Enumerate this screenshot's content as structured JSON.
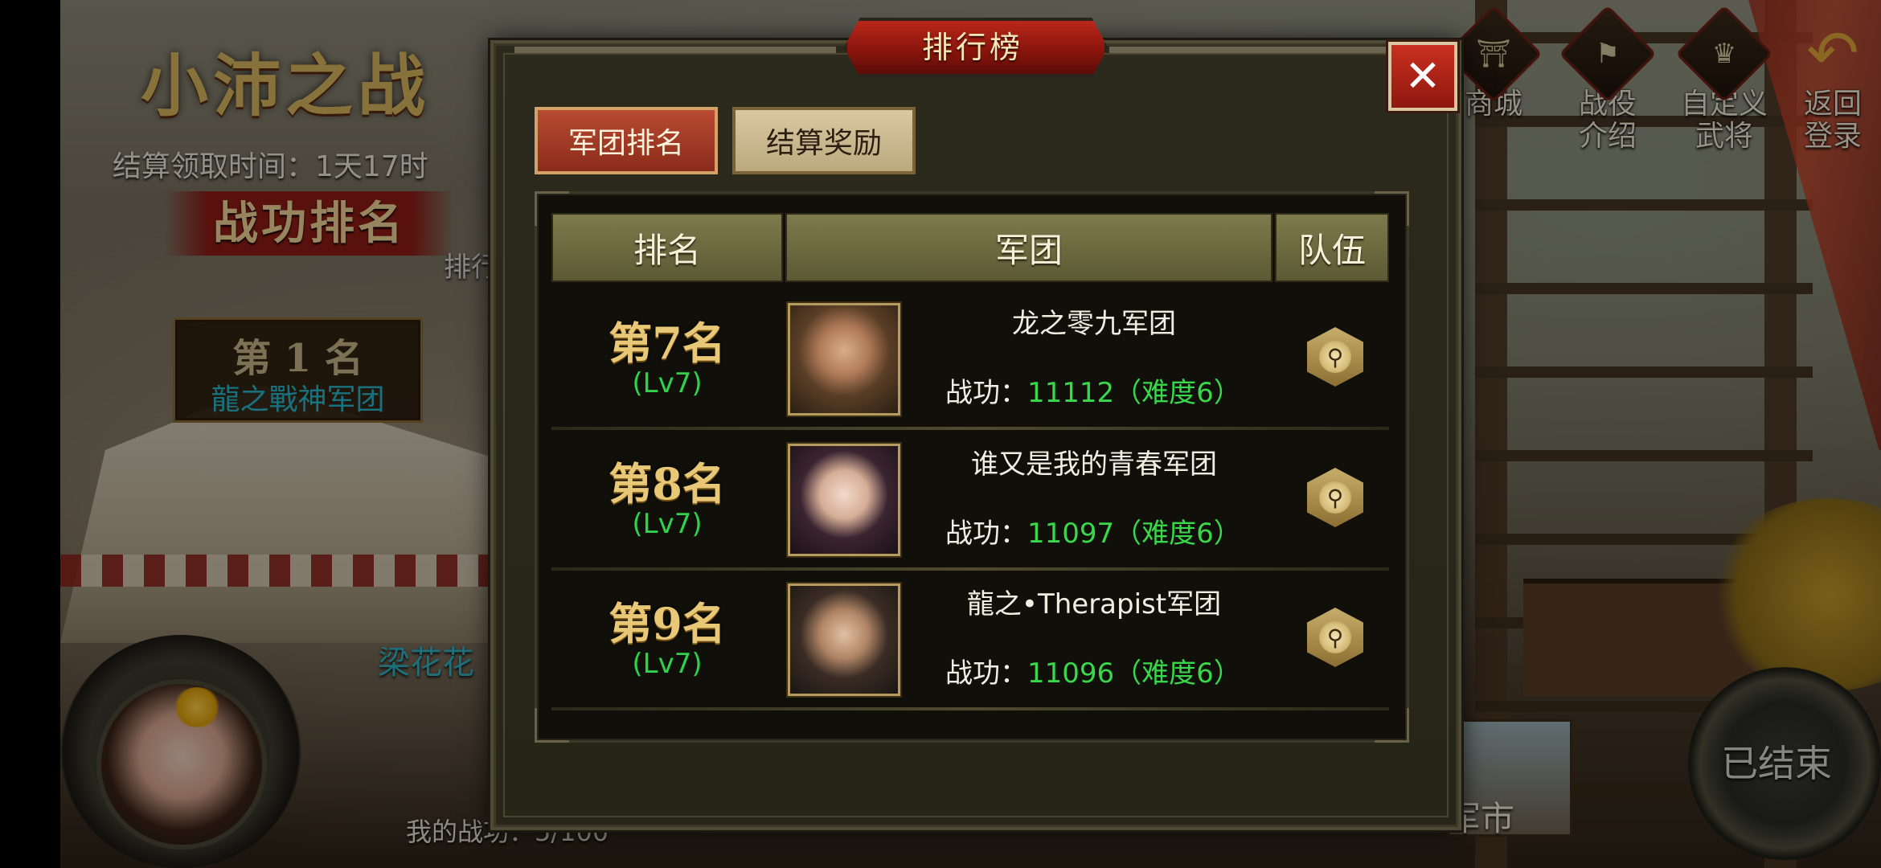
{
  "background": {
    "title": "小沛之战",
    "settle_time": "结算领取时间：1天17时",
    "rank_banner": "战功排名",
    "ranklist_label": "排行",
    "first_place": {
      "rank": "第 1 名",
      "name": "龍之戰神军团"
    },
    "player_name": "梁花花",
    "my_stats": "我的战功：5/100",
    "market_label": "军市",
    "ended_button": "已结束"
  },
  "nav": {
    "items": [
      {
        "label": "商城",
        "icon": "shop-icon"
      },
      {
        "label": "战役\n介绍",
        "icon": "campaign-icon"
      },
      {
        "label": "自定义\n武将",
        "icon": "custom-general-icon"
      },
      {
        "label": "返回\n登录",
        "icon": "back-icon"
      }
    ]
  },
  "dialog": {
    "title": "排行榜",
    "close_label": "✕",
    "tabs": [
      {
        "label": "军团排名",
        "active": true
      },
      {
        "label": "结算奖励",
        "active": false
      }
    ],
    "columns": [
      "排名",
      "军团",
      "队伍"
    ],
    "rows": [
      {
        "rank": "第7名",
        "level": "(Lv7)",
        "name": "龙之零九军团",
        "power_label": "战功：",
        "power": "11112（难度6）",
        "portrait": "male-general-portrait"
      },
      {
        "rank": "第8名",
        "level": "(Lv7)",
        "name": "谁又是我的青春军团",
        "power_label": "战功：",
        "power": "11097（难度6）",
        "portrait": "female-general-portrait"
      },
      {
        "rank": "第9名",
        "level": "(Lv7)",
        "name": "龍之•Therapist军团",
        "power_label": "战功：",
        "power": "11096（难度6）",
        "portrait": "young-general-portrait"
      }
    ]
  },
  "colors": {
    "accent_red": "#b9271a",
    "gold": "#e8c877",
    "green_value": "#39d84a",
    "cyan_name": "#29b7ca"
  }
}
